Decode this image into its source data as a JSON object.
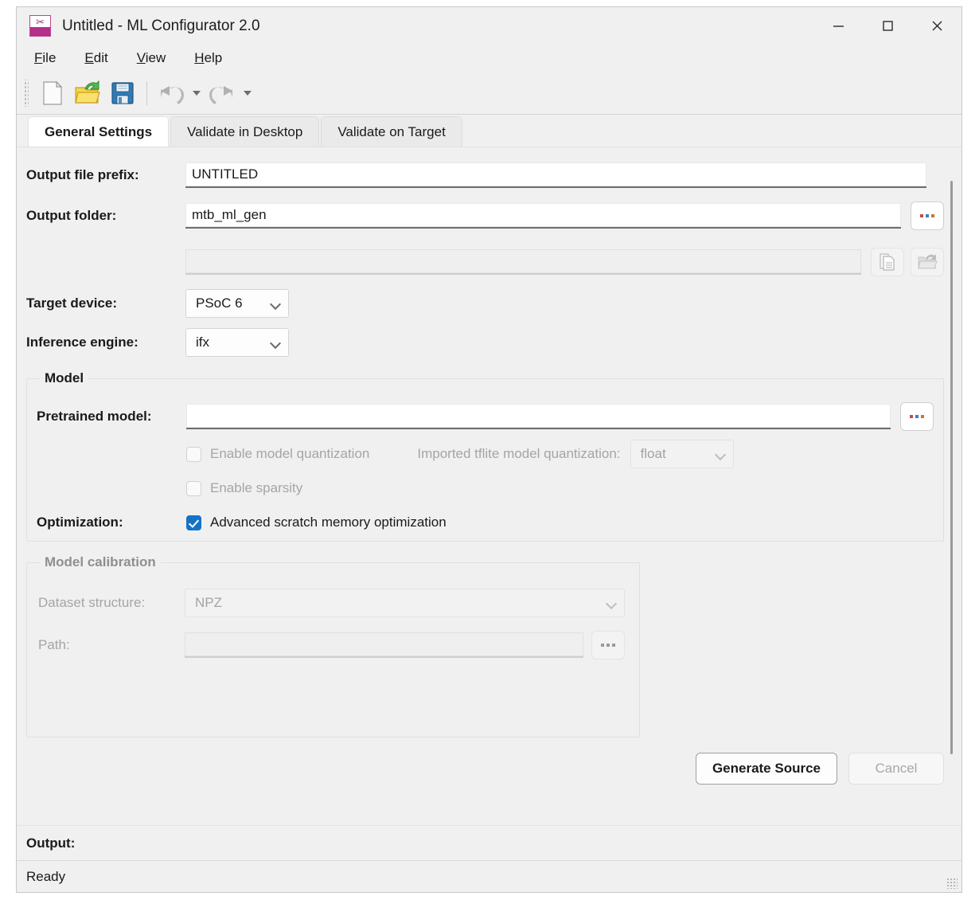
{
  "window": {
    "title": "Untitled - ML Configurator 2.0",
    "icon": "ml-configurator-app-icon",
    "minimize": "minimize",
    "maximize": "maximize",
    "close": "close"
  },
  "menubar": {
    "items": [
      {
        "label": "File",
        "accel": "F"
      },
      {
        "label": "Edit",
        "accel": "E"
      },
      {
        "label": "View",
        "accel": "V"
      },
      {
        "label": "Help",
        "accel": "H"
      }
    ]
  },
  "toolbar": {
    "buttons": [
      {
        "name": "new-file-icon",
        "tip": "New"
      },
      {
        "name": "open-folder-icon",
        "tip": "Open"
      },
      {
        "name": "save-icon",
        "tip": "Save"
      },
      {
        "name": "undo-icon",
        "tip": "Undo"
      },
      {
        "name": "redo-icon",
        "tip": "Redo"
      }
    ]
  },
  "tabs": [
    {
      "label": "General Settings",
      "active": true
    },
    {
      "label": "Validate in Desktop",
      "active": false
    },
    {
      "label": "Validate on Target",
      "active": false
    }
  ],
  "general": {
    "output_prefix": {
      "label": "Output file prefix:",
      "value": "UNTITLED"
    },
    "output_folder": {
      "label": "Output folder:",
      "value": "mtb_ml_gen",
      "browse_label": "...",
      "secondary_value": "",
      "copy_icon": "copy-path-icon",
      "open_icon": "open-folder-icon"
    },
    "target_device": {
      "label": "Target device:",
      "value": "PSoC 6"
    },
    "inference_engine": {
      "label": "Inference engine:",
      "value": "ifx"
    }
  },
  "model_group": {
    "title": "Model",
    "pretrained": {
      "label": "Pretrained model:",
      "value": "",
      "browse_label": "..."
    },
    "enable_quantization": {
      "label": "Enable model quantization",
      "checked": false,
      "enabled": false
    },
    "imported_quantization": {
      "label": "Imported tflite model quantization:",
      "value": "float",
      "enabled": false
    },
    "enable_sparsity": {
      "label": "Enable sparsity",
      "checked": false,
      "enabled": false
    },
    "optimization": {
      "label": "Optimization:",
      "checkbox_label": "Advanced scratch memory optimization",
      "checked": true,
      "enabled": true
    }
  },
  "calibration_group": {
    "title": "Model calibration",
    "enabled": false,
    "dataset_structure": {
      "label": "Dataset structure:",
      "value": "NPZ"
    },
    "path": {
      "label": "Path:",
      "value": "",
      "browse_label": "..."
    }
  },
  "actions": {
    "generate": "Generate Source",
    "cancel": "Cancel"
  },
  "output": {
    "label": "Output:"
  },
  "status": {
    "text": "Ready"
  },
  "colors": {
    "accent_blue": "#1573c4",
    "app_icon_magenta": "#b5308a",
    "window_bg": "#f0f0f0",
    "disabled_text": "#a5a5a5"
  }
}
